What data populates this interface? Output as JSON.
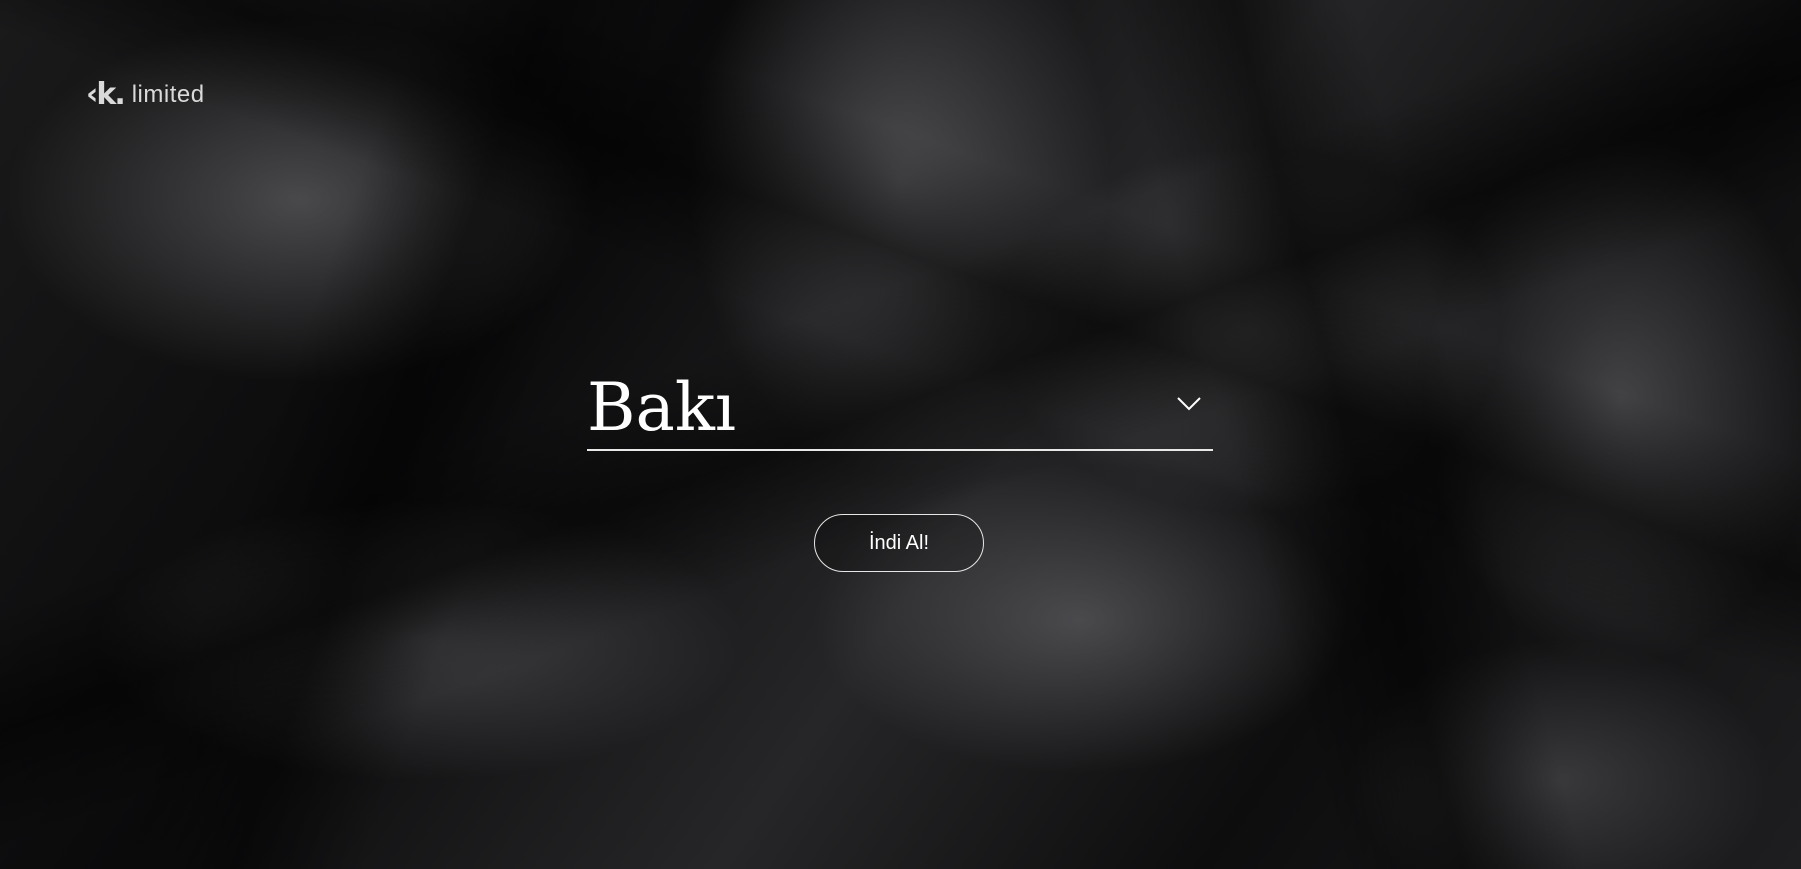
{
  "brand": {
    "mark": "‹k.",
    "name": "limited"
  },
  "city_select": {
    "selected_value": "Bakı",
    "icon": "chevron-down-icon"
  },
  "cta": {
    "label": "İndi Al!"
  },
  "colors": {
    "background": "#0b0b0c",
    "text": "#ffffff",
    "outline": "#e6e6e6"
  }
}
